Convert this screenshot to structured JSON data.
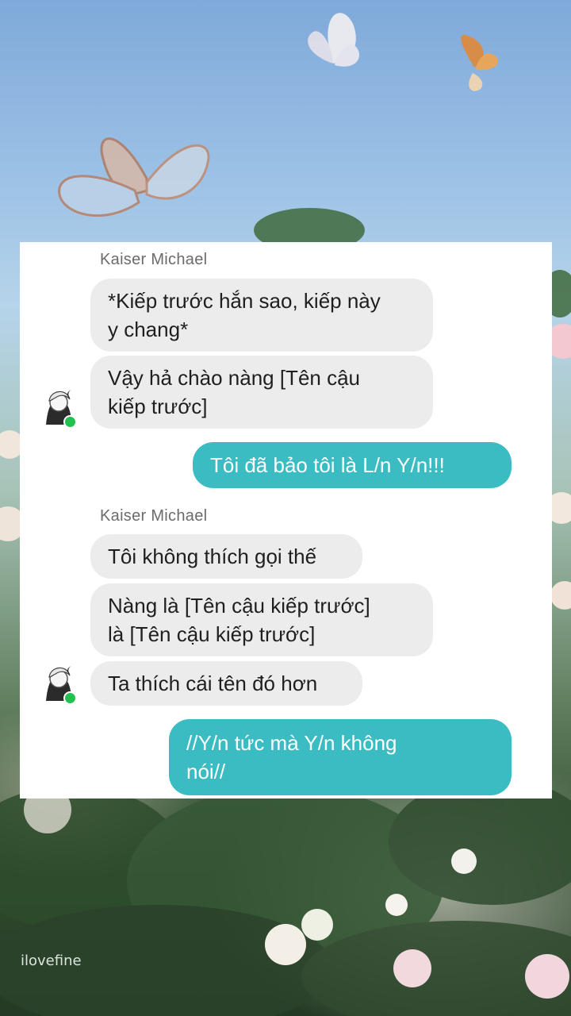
{
  "background": {
    "watermark": "ilovefine"
  },
  "chat": {
    "groups": [
      {
        "sender": "Kaiser Michael",
        "messages": [
          {
            "line1": "*Kiếp trước hắn sao, kiếp này",
            "line2": "y chang*"
          },
          {
            "line1": "Vậy hả chào nàng [Tên cậu",
            "line2": "kiếp trước]"
          }
        ]
      },
      {
        "outgoing": "Tôi đã bảo tôi là L/n Y/n!!!"
      },
      {
        "sender": "Kaiser Michael",
        "messages": [
          {
            "line1": "Tôi không thích gọi thế"
          },
          {
            "line1": "Nàng là [Tên cậu kiếp trước]",
            "line2": "là [Tên cậu kiếp trước]"
          },
          {
            "line1": "Ta thích cái tên đó hơn"
          }
        ]
      },
      {
        "outgoing_line1": "//Y/n tức mà Y/n không",
        "outgoing_line2": "nói//"
      }
    ],
    "colors": {
      "incoming_bubble": "#ececec",
      "outgoing_bubble": "#3bbcc3",
      "online_dot": "#22c04f"
    }
  }
}
